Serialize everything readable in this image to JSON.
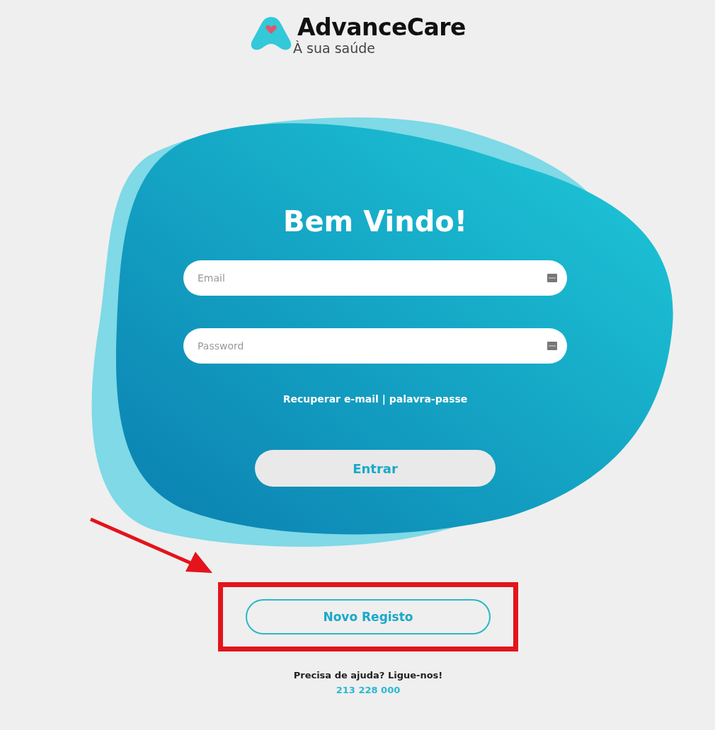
{
  "logo": {
    "name": "AdvanceCare",
    "tagline": "À sua saúde"
  },
  "heading": "Bem Vindo!",
  "fields": [
    {
      "placeholder": "Email"
    },
    {
      "placeholder": "Password"
    }
  ],
  "recover_link": "Recuperar e-mail | palavra-passe",
  "login_button": "Entrar",
  "register_button": {
    "label": "Novo Registo",
    "highlighted": true
  },
  "help": {
    "text": "Precisa de ajuda? Ligue-nos!",
    "phone": "213 228 000"
  }
}
